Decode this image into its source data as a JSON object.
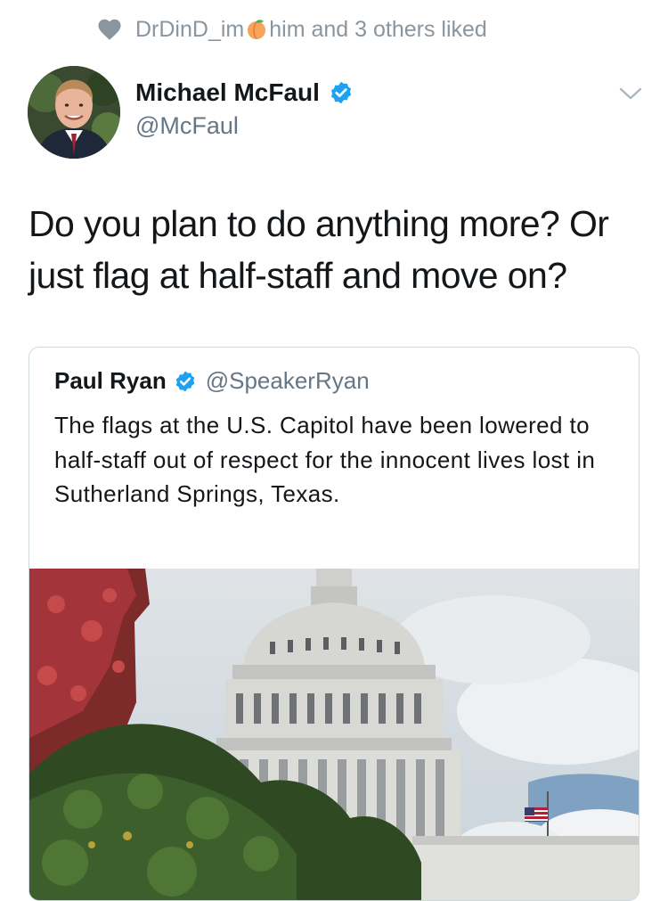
{
  "social_context": {
    "liker_name": "DrDinD_im",
    "liker_suffix_text": "him and 3 others liked",
    "heart_icon": "heart-icon",
    "emoji_icon": "peach-icon"
  },
  "tweet": {
    "author_name": "Michael McFaul",
    "author_handle": "@McFaul",
    "verified": true,
    "text": "Do you plan to do anything more? Or just flag at half-staff and move on?",
    "menu_icon": "chevron-down-icon"
  },
  "quoted_tweet": {
    "author_name": "Paul Ryan",
    "author_handle": "@SpeakerRyan",
    "verified": true,
    "text": "The flags at the U.S. Capitol have been lowered to half-staff out of respect for the innocent lives lost in Sutherland Springs, Texas.",
    "image": "photo of the U.S. Capitol dome with flag at half-staff"
  },
  "colors": {
    "verified_blue": "#1da1f2",
    "secondary_text": "#657786",
    "context_gray": "#8a959e"
  }
}
